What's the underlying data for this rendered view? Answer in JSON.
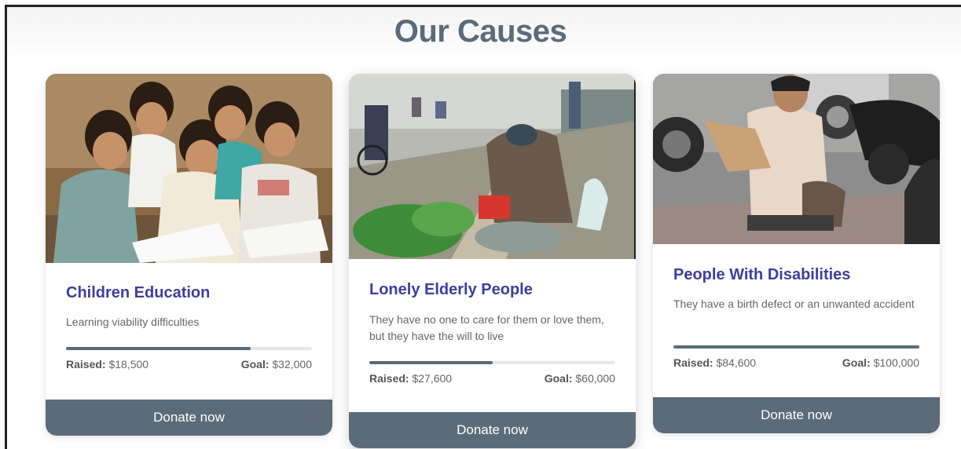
{
  "section": {
    "title": "Our Causes"
  },
  "colors": {
    "accent": "#5b6b7a",
    "title": "#3d3f9e",
    "heading": "#5a6b7b"
  },
  "causes": [
    {
      "title": "Children Education",
      "description": "Learning viability difficulties",
      "raised_label": "Raised:",
      "raised": "$18,500",
      "goal_label": "Goal:",
      "goal": "$32,000",
      "progress": 0.75,
      "button": "Donate now",
      "image": "children-reading-photo"
    },
    {
      "title": "Lonely Elderly People",
      "description": "They have no one to care for them or love them, but they have the will to live",
      "raised_label": "Raised:",
      "raised": "$27,600",
      "goal_label": "Goal:",
      "goal": "$60,000",
      "progress": 0.5,
      "button": "Donate now",
      "image": "elderly-street-vendor-photo"
    },
    {
      "title": "People With Disabilities",
      "description": "They have a birth defect or an unwanted accident",
      "raised_label": "Raised:",
      "raised": "$84,600",
      "goal_label": "Goal:",
      "goal": "$100,000",
      "progress": 1.0,
      "button": "Donate now",
      "image": "disabled-woman-street-photo"
    }
  ]
}
